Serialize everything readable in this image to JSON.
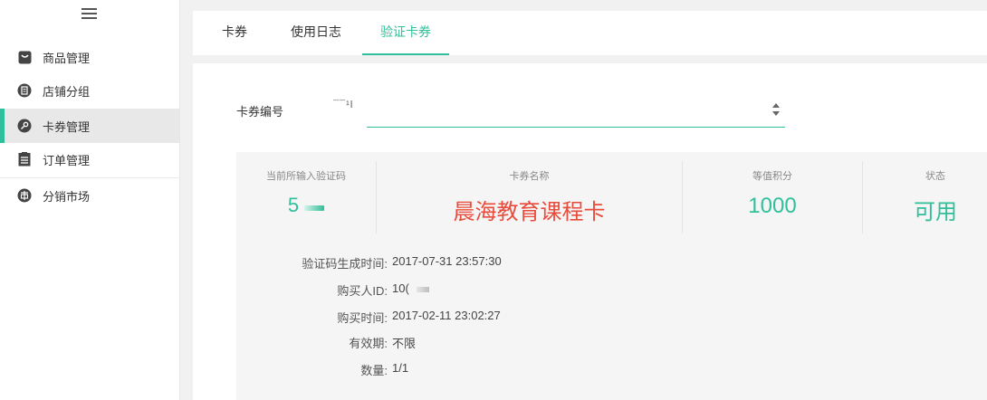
{
  "sidebar": {
    "items": [
      {
        "label": "商品管理",
        "icon": "bag-icon",
        "active": false
      },
      {
        "label": "店铺分组",
        "icon": "list-circle-icon",
        "active": false
      },
      {
        "label": "卡券管理",
        "icon": "key-circle-icon",
        "active": true
      },
      {
        "label": "订单管理",
        "icon": "clipboard-icon",
        "active": false
      },
      {
        "label": "分销市场",
        "icon": "market-circle-icon",
        "active": false
      }
    ]
  },
  "tabs": [
    {
      "label": "卡券",
      "active": false
    },
    {
      "label": "使用日志",
      "active": false
    },
    {
      "label": "验证卡券",
      "active": true
    }
  ],
  "search": {
    "label": "卡券编号",
    "value": "",
    "stub": "¯¯¹l"
  },
  "result": {
    "columns": {
      "code_header": "当前所输入验证码",
      "code_value": "5",
      "name_header": "卡券名称",
      "name_value": "晨海教育课程卡",
      "points_header": "等值积分",
      "points_value": "1000",
      "status_header": "状态",
      "status_value": "可用"
    },
    "details": [
      {
        "key": "验证码生成时间:",
        "value": "2017-07-31 23:57:30"
      },
      {
        "key": "购买人ID:",
        "value": "10("
      },
      {
        "key": "购买时间:",
        "value": "2017-02-11 23:02:27"
      },
      {
        "key": "有效期:",
        "value": "不限"
      },
      {
        "key": "数量:",
        "value": "1/1"
      }
    ]
  },
  "colors": {
    "accent": "#2fbf9a",
    "name_red": "#e74c3c"
  }
}
